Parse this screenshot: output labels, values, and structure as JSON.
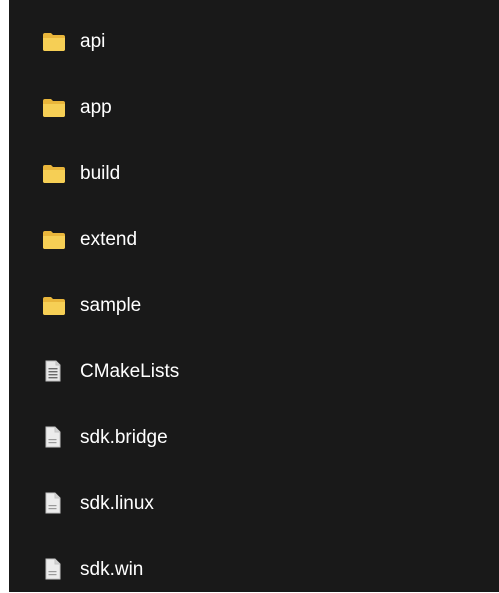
{
  "explorer": {
    "items": [
      {
        "name": "api",
        "type": "folder",
        "icon": "folder-icon"
      },
      {
        "name": "app",
        "type": "folder",
        "icon": "folder-icon"
      },
      {
        "name": "build",
        "type": "folder",
        "icon": "folder-icon"
      },
      {
        "name": "extend",
        "type": "folder",
        "icon": "folder-icon"
      },
      {
        "name": "sample",
        "type": "folder",
        "icon": "folder-icon"
      },
      {
        "name": "CMakeLists",
        "type": "file",
        "icon": "text-document-icon"
      },
      {
        "name": "sdk.bridge",
        "type": "file",
        "icon": "blank-document-icon"
      },
      {
        "name": "sdk.linux",
        "type": "file",
        "icon": "blank-document-icon"
      },
      {
        "name": "sdk.win",
        "type": "file",
        "icon": "blank-document-icon"
      }
    ]
  },
  "colors": {
    "background": "#191919",
    "text": "#ffffff",
    "folder": "#f4c84a",
    "document": "#e6e6e6"
  }
}
